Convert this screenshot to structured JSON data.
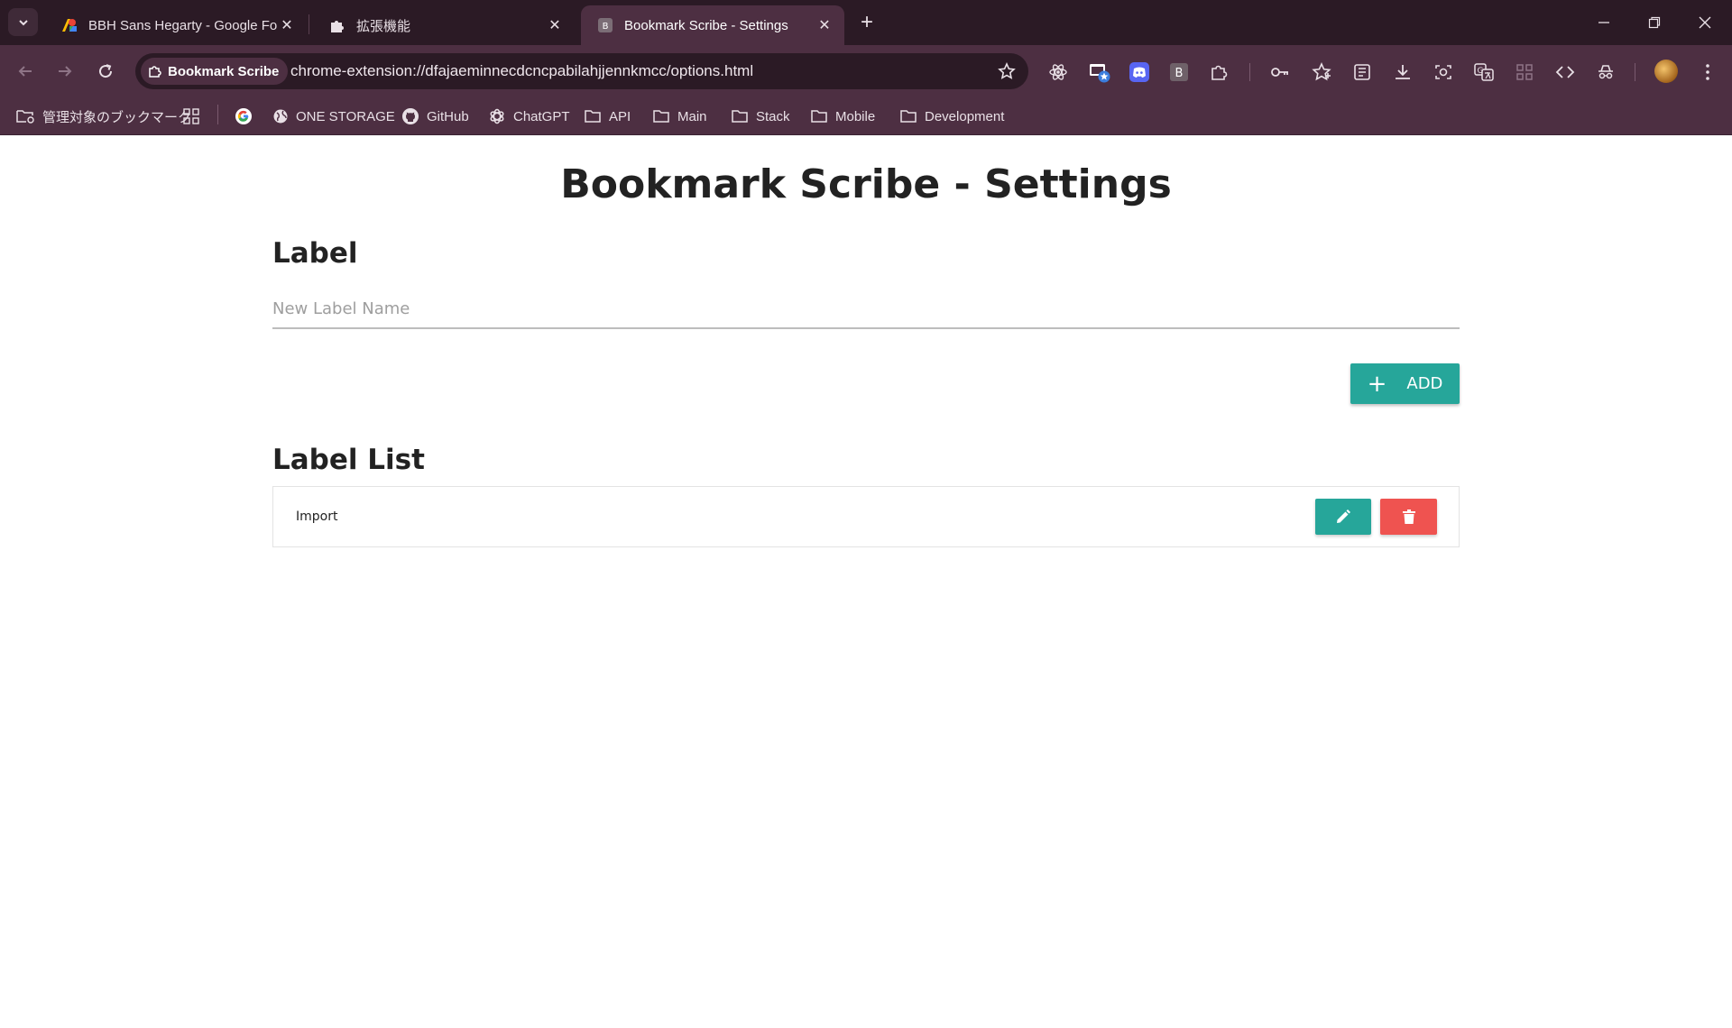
{
  "browser": {
    "tabs": [
      {
        "title": "BBH Sans Hegarty - Google Fon",
        "icon": "google-fonts-icon",
        "active": false
      },
      {
        "title": "拡張機能",
        "icon": "puzzle-icon",
        "active": false
      },
      {
        "title": "Bookmark Scribe - Settings",
        "icon": "extension-b-icon",
        "active": true
      }
    ],
    "omnibox": {
      "chip_label": "Bookmark Scribe",
      "url": "chrome-extension://dfajaeminnecdcncpabilahjjennkmcc/options.html"
    },
    "extension_badge": "B",
    "bookmarks": [
      {
        "label": "管理対象のブックマーク",
        "icon": "managed-folder-icon"
      },
      {
        "label": "",
        "icon": "apps-grid-icon"
      },
      {
        "label": "",
        "icon": "google-icon"
      },
      {
        "label": "ONE STORAGE",
        "icon": "globe-icon"
      },
      {
        "label": "GitHub",
        "icon": "github-icon"
      },
      {
        "label": "ChatGPT",
        "icon": "chatgpt-icon"
      },
      {
        "label": "API",
        "icon": "folder-icon"
      },
      {
        "label": "Main",
        "icon": "folder-icon"
      },
      {
        "label": "Stack",
        "icon": "folder-icon"
      },
      {
        "label": "Mobile",
        "icon": "folder-icon"
      },
      {
        "label": "Development",
        "icon": "folder-icon"
      }
    ]
  },
  "settings": {
    "title": "Bookmark Scribe - Settings",
    "label_section": {
      "heading": "Label",
      "input_placeholder": "New Label Name",
      "input_value": "",
      "add_button_label": "ADD"
    },
    "list_section": {
      "heading": "Label List",
      "items": [
        {
          "label": "Import"
        }
      ]
    }
  },
  "colors": {
    "chrome_dark": "#2b1a25",
    "chrome_toolbar": "#4d2f42",
    "accent_teal": "#26a69a",
    "danger_red": "#ef5350"
  }
}
